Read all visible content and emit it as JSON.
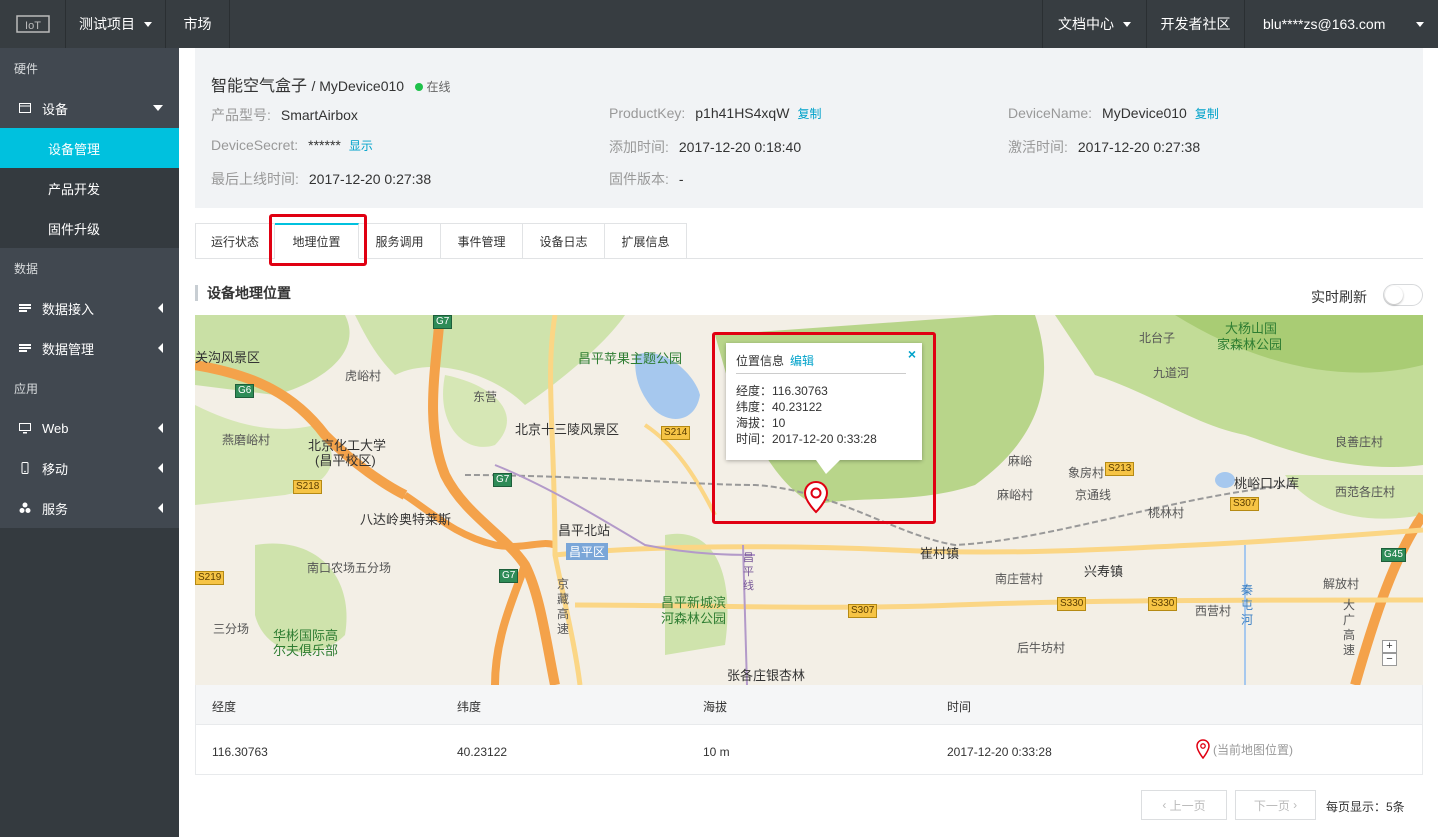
{
  "topbar": {
    "project": "测试项目",
    "market": "市场",
    "docs": "文档中心",
    "community": "开发者社区",
    "user": "blu****zs@163.com"
  },
  "sidebar": {
    "group_hardware": "硬件",
    "device": "设备",
    "device_manage": "设备管理",
    "product_dev": "产品开发",
    "firmware": "固件升级",
    "group_data": "数据",
    "data_access": "数据接入",
    "data_manage": "数据管理",
    "group_app": "应用",
    "web": "Web",
    "mobile": "移动",
    "service": "服务"
  },
  "device": {
    "product_name": "智能空气盒子",
    "device_name": "MyDevice010",
    "status": "在线",
    "model_label": "产品型号:",
    "model": "SmartAirbox",
    "productkey_label": "ProductKey:",
    "productkey": "p1h41HS4xqW",
    "copy": "复制",
    "devicename_label": "DeviceName:",
    "devicename": "MyDevice010",
    "secret_label": "DeviceSecret:",
    "secret": "******",
    "show": "显示",
    "added_label": "添加时间:",
    "added": "2017-12-20 0:18:40",
    "activated_label": "激活时间:",
    "activated": "2017-12-20 0:27:38",
    "last_online_label": "最后上线时间:",
    "last_online": "2017-12-20 0:27:38",
    "firmware_label": "固件版本:",
    "firmware": "-"
  },
  "tabs": [
    "运行状态",
    "地理位置",
    "服务调用",
    "事件管理",
    "设备日志",
    "扩展信息"
  ],
  "section": {
    "title": "设备地理位置",
    "realtime": "实时刷新"
  },
  "popup": {
    "title": "位置信息",
    "edit": "编辑",
    "close": "×",
    "lng": "经度：116.30763",
    "lat": "纬度：40.23122",
    "alt": "海拔：10",
    "time": "时间：2017-12-20 0:33:28"
  },
  "map_labels": {
    "l1": "关沟风景区",
    "l2": "虎峪村",
    "l3": "东营",
    "l4": "昌平苹果主题公园",
    "l5": "北京十三陵风景区",
    "l6": "北京化工大学",
    "l7": "(昌平校区)",
    "l8": "燕磨峪村",
    "l9": "八达岭奥特莱斯",
    "l10": "昌平北站",
    "l11": "昌平区",
    "l12": "南口农场五分场",
    "l13": "三分场",
    "l14": "华彬国际高",
    "l15": "尔夫俱乐部",
    "l16": "昌平新城滨",
    "l17": "河森林公园",
    "l18": "张各庄银杏林",
    "l19": "大杨山国",
    "l20": "家森林公园",
    "l21": "北台子",
    "l22": "九道河",
    "l23": "麻峪",
    "l24": "象房村",
    "l25": "良善庄村",
    "l26": "麻峪村",
    "l27": "京通线",
    "l28": "桃峪口水库",
    "l29": "西范各庄村",
    "l30": "桃林村",
    "l31": "崔村镇",
    "l32": "南庄营村",
    "l33": "兴寿镇",
    "l34": "西营村",
    "l35": "解放村",
    "l36": "后牛坊村",
    "l37": "秦屯河",
    "l38": "京藏高速",
    "l39": "昌平线",
    "l40": "大广高速"
  },
  "road_shields": [
    "G6",
    "G7",
    "S214",
    "S218",
    "G7",
    "S219",
    "G7",
    "S307",
    "S213",
    "S307",
    "S330",
    "S330",
    "G45"
  ],
  "table": {
    "headers": [
      "经度",
      "纬度",
      "海拔",
      "时间"
    ],
    "row": [
      "116.30763",
      "40.23122",
      "10 m",
      "2017-12-20 0:33:28"
    ],
    "current": "(当前地图位置)"
  },
  "pager": {
    "prev": "上一页",
    "next": "下一页",
    "per_page": "每页显示：5条"
  },
  "colors": {
    "accent": "#00c1de",
    "topbar": "#373d41",
    "sidebar": "#414850",
    "highlight": "#e00012",
    "online": "#1ec14a"
  }
}
